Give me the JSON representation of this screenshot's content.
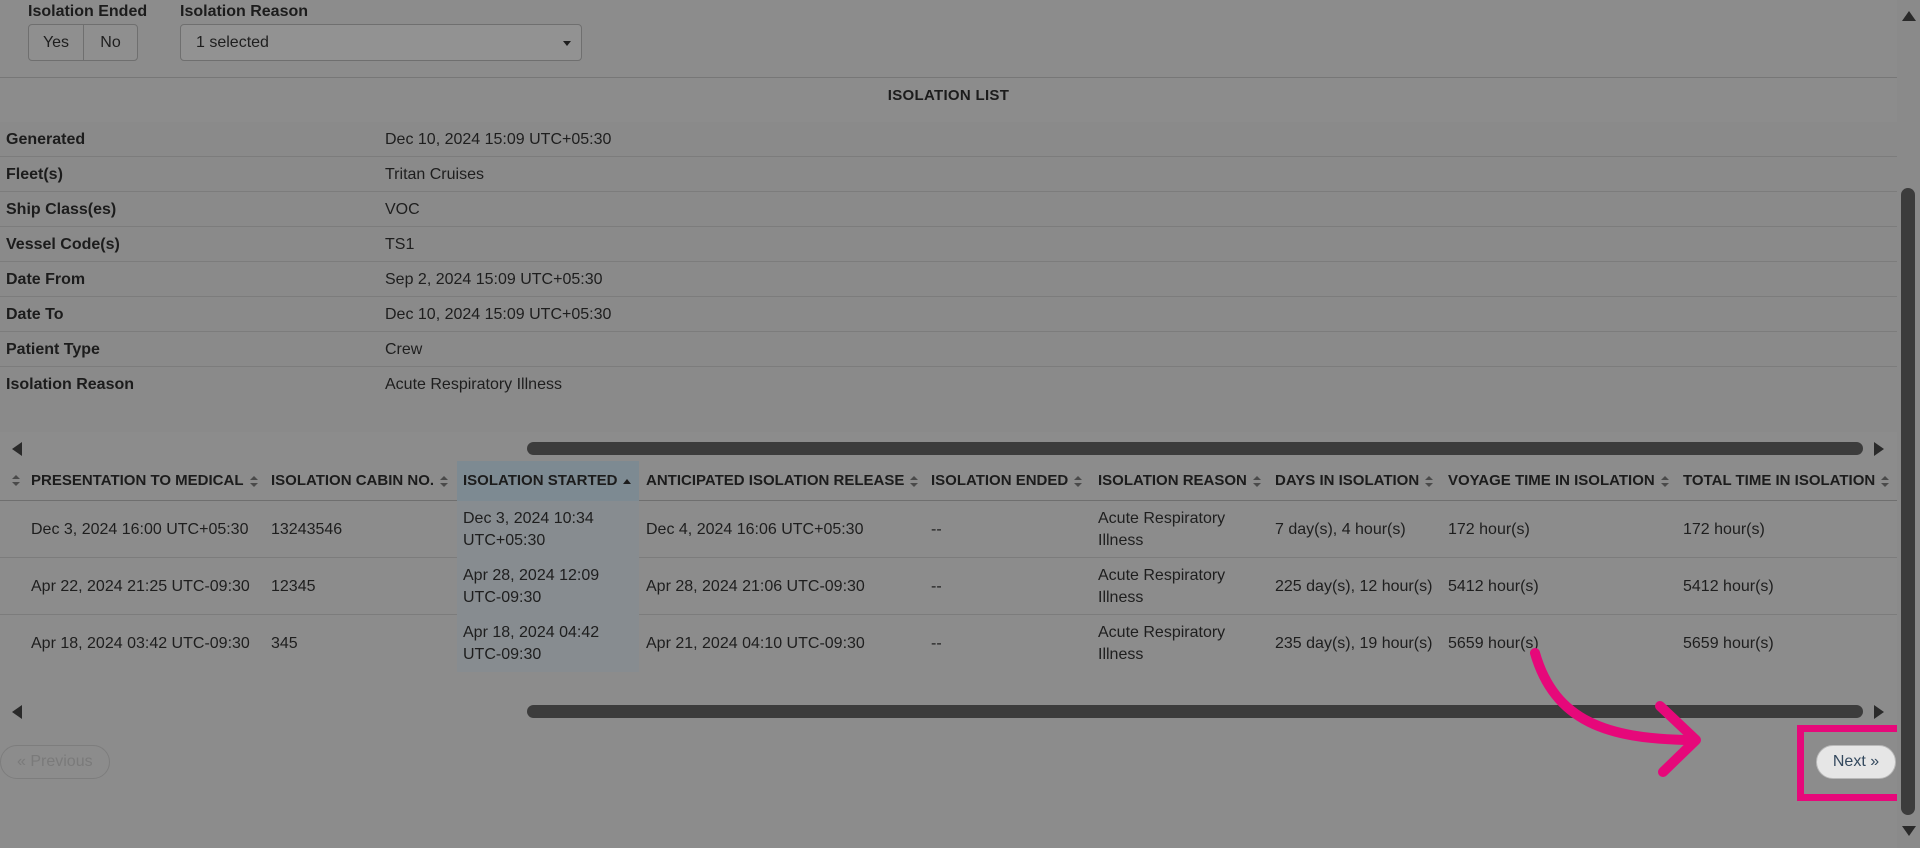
{
  "filters": {
    "isolation_ended_label": "Isolation Ended",
    "yes_label": "Yes",
    "no_label": "No",
    "isolation_reason_label": "Isolation Reason",
    "isolation_reason_value": "1 selected"
  },
  "list_title": "ISOLATION LIST",
  "report_info": [
    {
      "key": "Generated",
      "value": "Dec 10, 2024 15:09 UTC+05:30"
    },
    {
      "key": "Fleet(s)",
      "value": "Tritan Cruises"
    },
    {
      "key": "Ship Class(es)",
      "value": "VOC"
    },
    {
      "key": "Vessel Code(s)",
      "value": "TS1"
    },
    {
      "key": "Date From",
      "value": "Sep 2, 2024 15:09 UTC+05:30"
    },
    {
      "key": "Date To",
      "value": "Dec 10, 2024 15:09 UTC+05:30"
    },
    {
      "key": "Patient Type",
      "value": "Crew"
    },
    {
      "key": "Isolation Reason",
      "value": "Acute Respiratory Illness"
    }
  ],
  "table": {
    "columns": [
      "PRESENTATION TO MEDICAL",
      "ISOLATION CABIN NO.",
      "ISOLATION STARTED",
      "ANTICIPATED ISOLATION RELEASE",
      "ISOLATION ENDED",
      "ISOLATION REASON",
      "DAYS IN ISOLATION",
      "VOYAGE TIME IN ISOLATION",
      "TOTAL TIME IN ISOLATION"
    ],
    "sorted_column": "ISOLATION STARTED",
    "sort_direction": "ascending",
    "rows": [
      {
        "presentation": "Dec 3, 2024 16:00 UTC+05:30",
        "cabin": "13243546",
        "started_line1": "Dec 3, 2024 10:34",
        "started_line2": "UTC+05:30",
        "release": "Dec 4, 2024 16:06 UTC+05:30",
        "ended": "--",
        "reason_line1": "Acute Respiratory",
        "reason_line2": "Illness",
        "days": "7 day(s), 4 hour(s)",
        "voyage_time": "172 hour(s)",
        "total_time": "172 hour(s)"
      },
      {
        "presentation": "Apr 22, 2024 21:25 UTC-09:30",
        "cabin": "12345",
        "started_line1": "Apr 28, 2024 12:09",
        "started_line2": "UTC-09:30",
        "release": "Apr 28, 2024 21:06 UTC-09:30",
        "ended": "--",
        "reason_line1": "Acute Respiratory",
        "reason_line2": "Illness",
        "days": "225 day(s), 12 hour(s)",
        "voyage_time": "5412 hour(s)",
        "total_time": "5412 hour(s)"
      },
      {
        "presentation": "Apr 18, 2024 03:42 UTC-09:30",
        "cabin": "345",
        "started_line1": "Apr 18, 2024 04:42",
        "started_line2": "UTC-09:30",
        "release": "Apr 21, 2024 04:10 UTC-09:30",
        "ended": "--",
        "reason_line1": "Acute Respiratory",
        "reason_line2": "Illness",
        "days": "235 day(s), 19 hour(s)",
        "voyage_time": "5659 hour(s)",
        "total_time": "5659 hour(s)"
      }
    ]
  },
  "pagination": {
    "previous_label": "« Previous",
    "next_label": "Next »"
  },
  "annotation": {
    "highlight_color": "#e6087a",
    "arrow_icon": "curved-arrow-icon"
  },
  "colors": {
    "overlay_background": "#8c8c8c",
    "next_button_text": "#34495e"
  }
}
